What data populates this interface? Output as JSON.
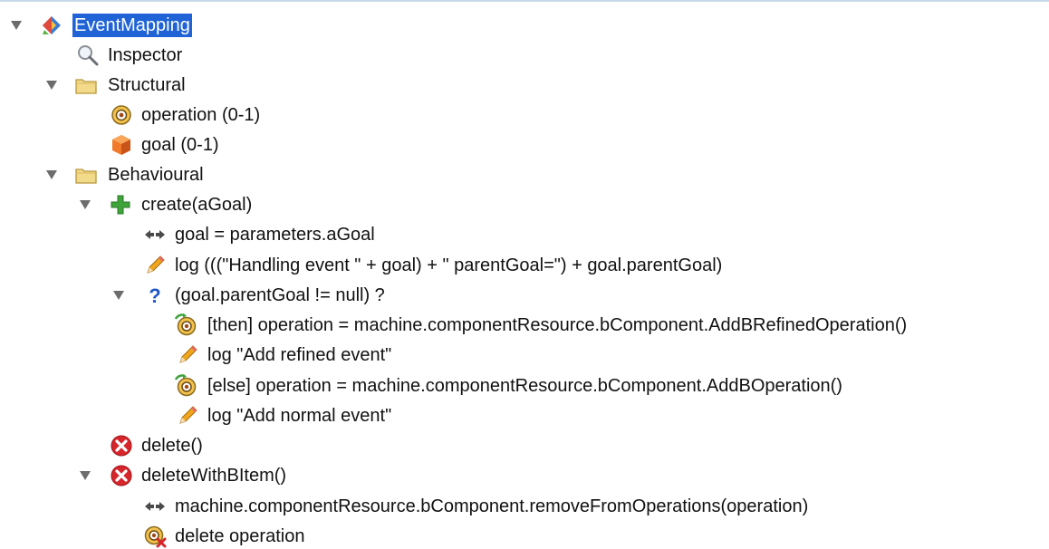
{
  "tree": {
    "root": {
      "label": "EventMapping",
      "icon": "event-mapping-icon",
      "selected": true
    },
    "inspector": {
      "label": "Inspector",
      "icon": "magnifier-icon"
    },
    "structural": {
      "label": "Structural",
      "icon": "folder-icon",
      "children": [
        {
          "label": "operation (0-1)",
          "icon": "operation-icon"
        },
        {
          "label": "goal (0-1)",
          "icon": "goal-cube-icon"
        }
      ]
    },
    "behavioural": {
      "label": "Behavioural",
      "icon": "folder-icon",
      "create": {
        "label": "create(aGoal)",
        "icon": "plus-icon",
        "assign": "goal = parameters.aGoal",
        "log": "log (((\"Handling event \" + goal) + \" parentGoal=\") + goal.parentGoal)",
        "conditional": {
          "label": "(goal.parentGoal != null) ?",
          "icon": "question-icon",
          "then_op": "[then] operation = machine.componentResource.bComponent.AddBRefinedOperation()",
          "then_log": "log \"Add refined event\"",
          "else_op": "[else] operation = machine.componentResource.bComponent.AddBOperation()",
          "else_log": "log \"Add normal event\""
        }
      },
      "delete": {
        "label": "delete()",
        "icon": "delete-icon"
      },
      "delete_with_bitem": {
        "label": "deleteWithBItem()",
        "icon": "delete-icon",
        "call": "machine.componentResource.bComponent.removeFromOperations(operation)",
        "delete_op": "delete operation"
      }
    }
  },
  "colors": {
    "selection": "#1f63d6",
    "toggle": "#6c6c6c",
    "folder": "#f3d98a",
    "plus": "#3ea33a",
    "question": "#1e56c9",
    "delete": "#d6262b",
    "pencil": "#f0a61c"
  }
}
